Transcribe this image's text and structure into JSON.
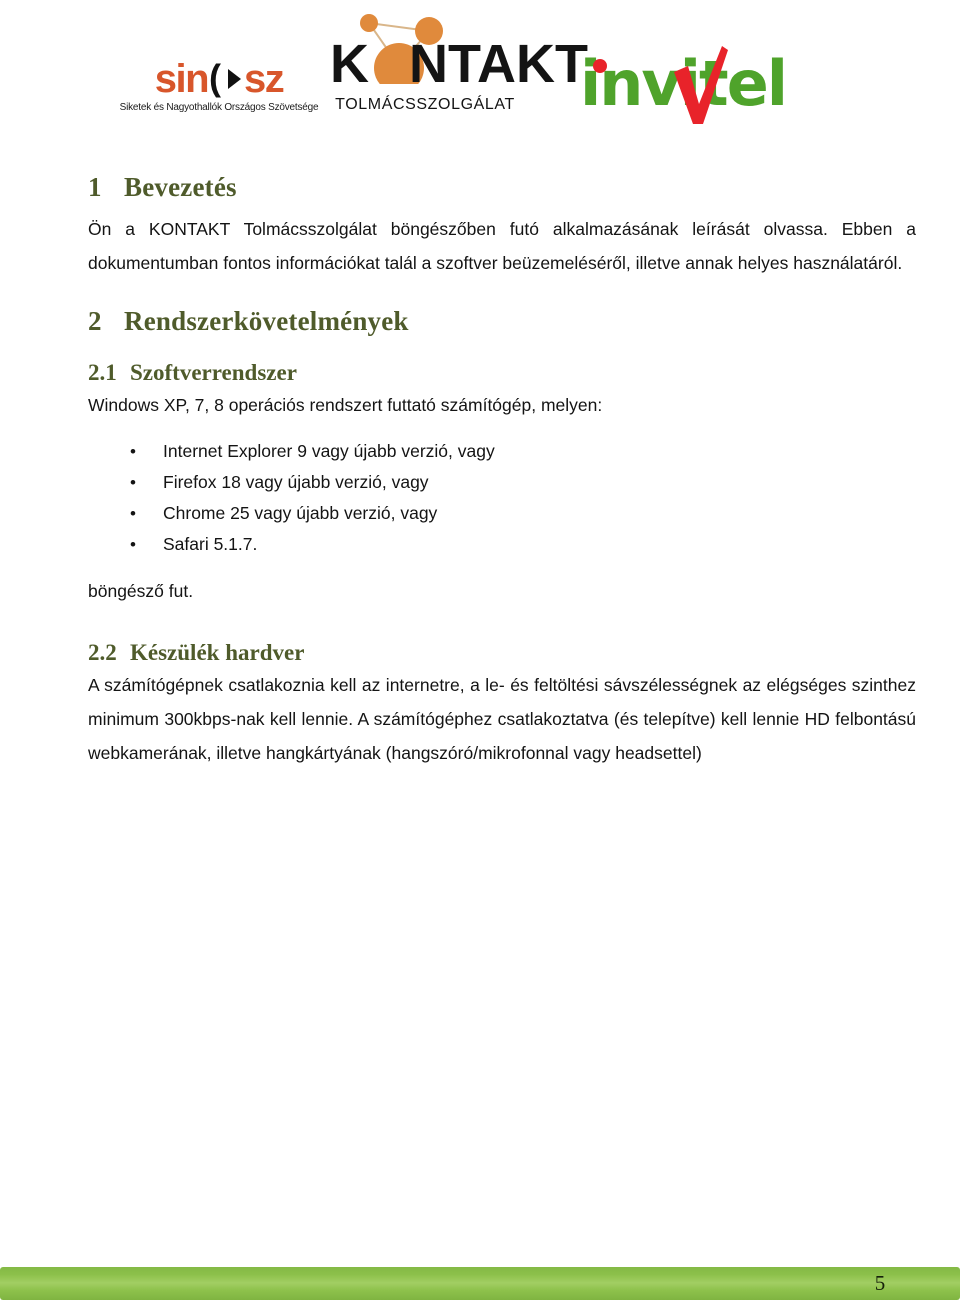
{
  "header": {
    "logos": [
      {
        "name": "sinosz",
        "word_left": "sin",
        "word_right": "sz",
        "tagline": "Siketek és Nagyothallók Országos Szövetsége",
        "color_word": "#D8562B",
        "color_mark": "#111111"
      },
      {
        "name": "kontakt",
        "word_before": "K",
        "word_after": "NTAKT",
        "subtitle": "TOLMÁCSSZOLGÁLAT",
        "color_text": "#141414",
        "color_accent": "#E08A3C"
      },
      {
        "name": "invitel",
        "word": "invitel",
        "color_text": "#4FA32B",
        "color_accent": "#E8232A"
      }
    ]
  },
  "document": {
    "sections": [
      {
        "number": "1",
        "title": "Bevezetés",
        "paragraph": "Ön a KONTAKT Tolmácsszolgálat böngészőben futó alkalmazásának leírását olvassa. Ebben a dokumentumban fontos információkat talál a szoftver beüzemeléséről, illetve annak helyes használatáról."
      },
      {
        "number": "2",
        "title": "Rendszerkövetelmények"
      }
    ],
    "subsection_1": {
      "number": "2.1",
      "title": "Szoftverrendszer",
      "intro": "Windows XP, 7, 8 operációs rendszert futtató számítógép, melyen:",
      "bullet_marker": "•",
      "bullets": [
        "Internet Explorer 9 vagy újabb verzió, vagy",
        "Firefox 18 vagy újabb verzió, vagy",
        "Chrome 25 vagy újabb verzió, vagy",
        "Safari 5.1.7."
      ],
      "outro": "böngésző fut."
    },
    "subsection_2": {
      "number": "2.2",
      "title": "Készülék hardver",
      "paragraph": "A számítógépnek csatlakoznia kell az internetre, a le- és feltöltési sávszélességnek az elégséges szinthez minimum 300kbps-nak kell lennie. A számítógéphez csatlakoztatva (és telepítve) kell lennie HD felbontású webkamerának, illetve hangkártyának (hangszóró/mikrofonnal vagy headsettel)"
    }
  },
  "footer": {
    "page_number": "5",
    "bar_color": "#8CC04A"
  }
}
